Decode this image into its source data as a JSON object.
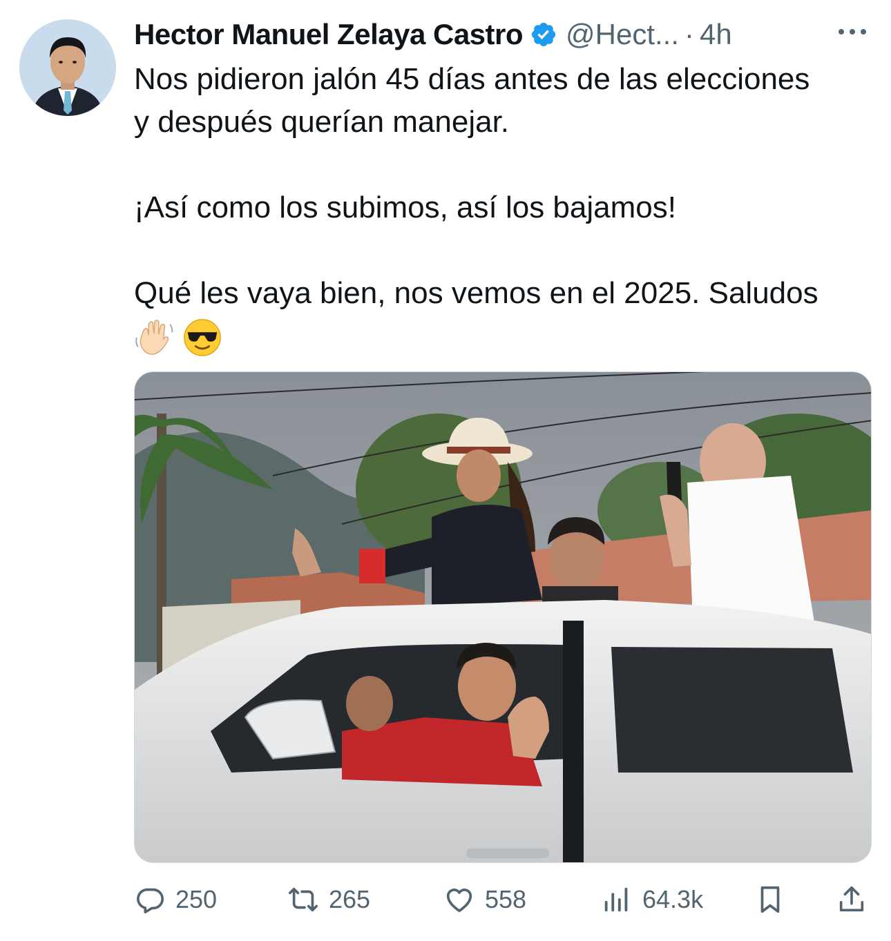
{
  "tweet": {
    "author_name": "Hector Manuel Zelaya Castro",
    "handle": "@Hect...",
    "separator": "·",
    "time": "4h",
    "lines": [
      "Nos pidieron jalón 45 días antes de las elecciones",
      "y después querían manejar.",
      "¡Así como los subimos, así los bajamos!",
      "Qué les vaya bien, nos vemos en el 2025. Saludos"
    ],
    "emojis": [
      "waving-hand-emoji",
      "sunglasses-face-emoji"
    ]
  },
  "actions": {
    "replies": "250",
    "retweets": "265",
    "likes": "558",
    "views": "64.3k"
  },
  "icons": {
    "avatar": "profile-avatar",
    "verified": "verified-badge-icon",
    "more": "more-options-icon",
    "reply": "reply-icon",
    "retweet": "retweet-icon",
    "like": "heart-icon",
    "views": "views-icon",
    "bookmark": "bookmark-icon",
    "share": "share-icon"
  },
  "colors": {
    "text": "#0f1419",
    "secondary": "#536471",
    "verified": "#1d9bf0"
  }
}
